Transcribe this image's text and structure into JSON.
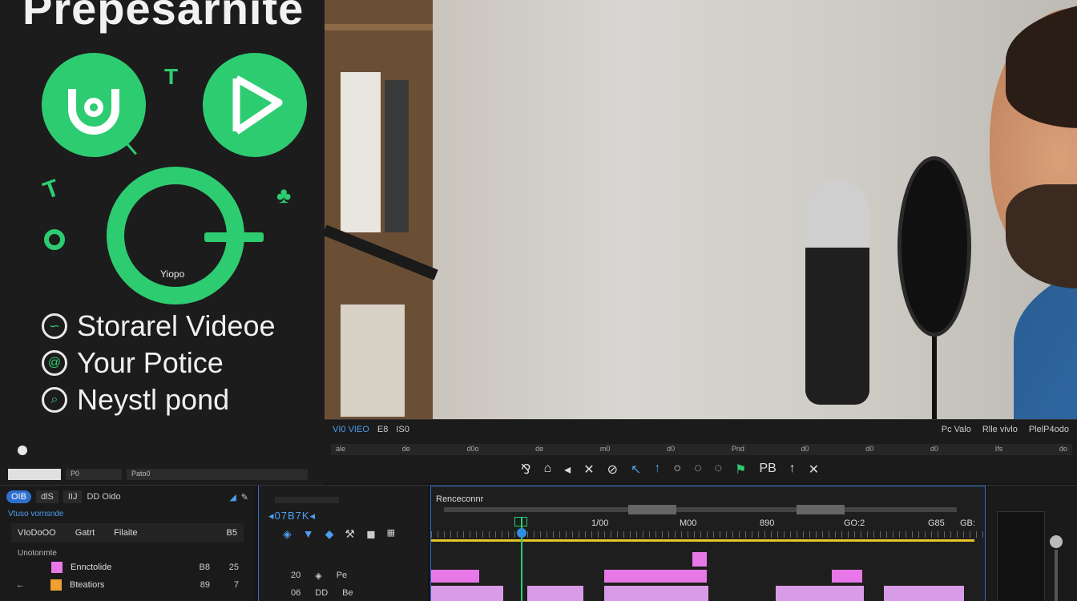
{
  "promo": {
    "title": "Prepesarnite",
    "ring_label": "Yiopo",
    "features": [
      {
        "label": "Storarel Videoe",
        "icon": "chat-bubble-icon"
      },
      {
        "label": "Your Potice",
        "icon": "at-sign-icon"
      },
      {
        "label": "Neystl pond",
        "icon": "search-icon"
      }
    ],
    "bottom_fields": [
      "",
      "P0",
      "Pato0"
    ]
  },
  "strip": {
    "row1_left": [
      "VI0 VIEO",
      "E8",
      "IS0"
    ],
    "row1_right": [
      "Pc Valo",
      "Rlle vivlo",
      "PlelP4odo"
    ],
    "ruler_labels": [
      "ale",
      "de",
      "d0o",
      "de",
      "m0",
      "d0",
      "Pnd",
      "d0",
      "d0",
      "d0",
      "Ifs",
      "do"
    ],
    "tools": [
      "⅋",
      "⌂",
      "◂",
      "✕",
      "⊘",
      "↖",
      "↑",
      "○",
      "◌",
      "◌",
      "⚑",
      "PB",
      "↑",
      "✕"
    ]
  },
  "project": {
    "tabs": [
      "OIB",
      "dlS",
      "IIJ",
      "DD Oido"
    ],
    "search": "Vtuso vornsnde",
    "header": {
      "name": "VIoDoOO",
      "col2": "Gatrt",
      "col3": "Filaite",
      "end": "B5"
    },
    "subheader": "Unotonmte",
    "rows": [
      {
        "name": "Ennctolide",
        "n1": "B8",
        "n2": "25",
        "color": "#e877e8"
      },
      {
        "name": "Bteatiors",
        "n1": "89",
        "n2": "7",
        "color": "#f0a030"
      }
    ]
  },
  "source": {
    "timecode": "◂07B7K◂",
    "row1": [
      "20",
      "◈",
      "Pe"
    ],
    "row2": [
      "06",
      "DD",
      "Be"
    ]
  },
  "timeline": {
    "title": "Renceconnr",
    "ticks": [
      "1/00",
      "M00",
      "890",
      "GO:2",
      "G85",
      "GB:"
    ]
  },
  "colors": {
    "accent_green": "#2ecc71",
    "accent_blue": "#2f6fd0",
    "clip_pink": "#e877e8"
  }
}
